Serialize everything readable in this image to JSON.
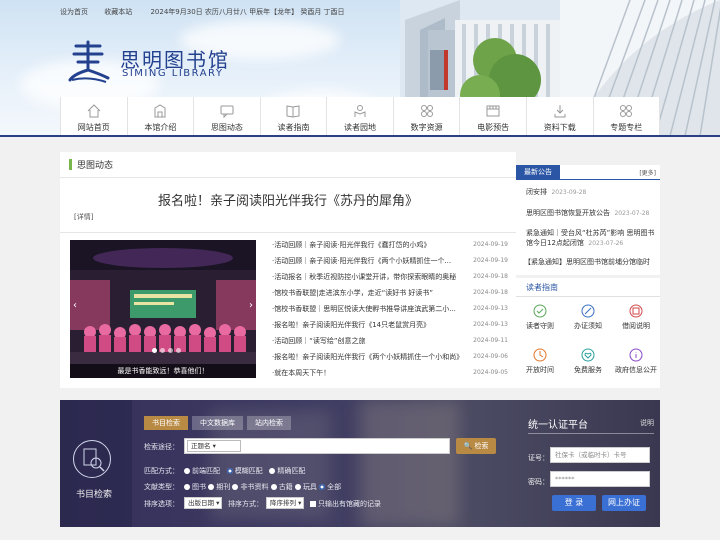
{
  "topbar": {
    "set_home": "设为首页",
    "favorite": "收藏本站",
    "date": "2024年9月30日 农历八月廿八 甲辰年【龙年】 癸酉月 丁酉日"
  },
  "logo": {
    "cn": "思明图书馆",
    "en": "SIMING LIBRARY"
  },
  "nav": [
    {
      "label": "网站首页",
      "icon": "home-icon"
    },
    {
      "label": "本馆介绍",
      "icon": "library-icon"
    },
    {
      "label": "思图动态",
      "icon": "chat-icon"
    },
    {
      "label": "读者指南",
      "icon": "book-icon"
    },
    {
      "label": "读者园地",
      "icon": "reader-icon"
    },
    {
      "label": "数字资源",
      "icon": "grid-icon"
    },
    {
      "label": "电影预告",
      "icon": "film-icon"
    },
    {
      "label": "资料下载",
      "icon": "download-icon"
    },
    {
      "label": "专题专栏",
      "icon": "apps-icon"
    }
  ],
  "news": {
    "section_title": "思图动态",
    "headline": "报名啦！亲子阅读阳光伴我行《苏丹的犀角》",
    "detail": "[详情]",
    "slide_caption": "最是书香能致远！恭喜他们！",
    "items": [
      {
        "text": "·活动回顾｜亲子阅读·阳光伴我行《蠢打岱的小鸡》",
        "date": "2024-09-19"
      },
      {
        "text": "·活动回顾｜亲子阅读·阳光伴我行《两个小妖精抓住一个...",
        "date": "2024-09-19"
      },
      {
        "text": "·活动报名｜秋季近视防控小课堂开讲，带你探索眼睛的奥秘",
        "date": "2024-09-18"
      },
      {
        "text": "·馆校书香联盟|走进滨东小学，走近“读好书 好读书”",
        "date": "2024-09-18"
      },
      {
        "text": "·馆校书香联盟｜思明区悦读大使孵书推导讲座滨武第二小...",
        "date": "2024-09-13"
      },
      {
        "text": "·报名啦！亲子阅读阳光伴我行《14只老鼠赏月亮》",
        "date": "2024-09-13"
      },
      {
        "text": "·活动回顾｜“读写绘”创意之旅",
        "date": "2024-09-11"
      },
      {
        "text": "·报名啦！亲子阅读阳光伴我行《两个小妖精抓住一个小和尚》",
        "date": "2024-09-06"
      },
      {
        "text": "·就在本周天下午！",
        "date": "2024-09-05"
      }
    ]
  },
  "notice": {
    "tab": "最新公告",
    "more": "[更多]",
    "items": [
      {
        "text": "闭安排",
        "date": "2023-09-28"
      },
      {
        "text": "思明区图书馆恢复开放公告",
        "date": "2023-07-28"
      },
      {
        "text": "紧急通知｜受台风“杜苏芮”影响 思明图书馆今日12点起闭馆",
        "date": "2023-07-26"
      },
      {
        "text": "【紧急通知】思明区图书馆前埔分馆临时",
        "date": ""
      }
    ]
  },
  "guide": {
    "title": "读者指南",
    "items": [
      {
        "label": "读者守则",
        "icon": "rules-icon",
        "color": "#5aa85a"
      },
      {
        "label": "办证须知",
        "icon": "card-icon",
        "color": "#3a6fc4"
      },
      {
        "label": "借阅说明",
        "icon": "borrow-icon",
        "color": "#d24a4a"
      },
      {
        "label": "开放时间",
        "icon": "clock-icon",
        "color": "#e0762a"
      },
      {
        "label": "免费服务",
        "icon": "heart-icon",
        "color": "#2aa0a0"
      },
      {
        "label": "政府信息公开",
        "icon": "info-icon",
        "color": "#8a4ac4"
      }
    ]
  },
  "search": {
    "icon_label": "书目检索",
    "tabs": [
      "书目检索",
      "中文数据库",
      "站内检索"
    ],
    "path_label": "检索途径：",
    "path_value": "正题名",
    "button": "检索",
    "match_label": "匹配方式：",
    "match_options": [
      "前端匹配",
      "模糊匹配",
      "精确匹配"
    ],
    "doc_label": "文献类型：",
    "doc_options": [
      "图书",
      "期刊",
      "非书资料",
      "古籍",
      "玩具",
      "全部"
    ],
    "sort_label": "排序选项：",
    "sort_value": "出版日期",
    "order_label": "排序方式：",
    "order_value": "降序排列",
    "holding_label": "只输出有馆藏的记录"
  },
  "auth": {
    "title": "统一认证平台",
    "help": "说明",
    "card_label": "证号：",
    "card_placeholder": "社保卡（或临时卡）卡号",
    "pwd_label": "密码：",
    "pwd_value": "******",
    "login": "登 录",
    "apply": "网上办证"
  }
}
